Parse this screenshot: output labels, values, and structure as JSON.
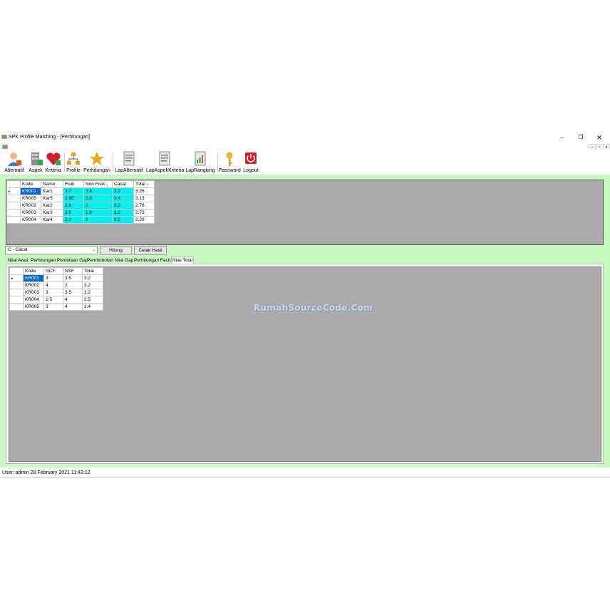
{
  "window": {
    "title": "SPK Profile Matching - [Perhitungan]",
    "minimize": "–",
    "maximize": "❐",
    "close": "✕",
    "mdi_minimize": "–",
    "mdi_restore": "▫",
    "mdi_close": "x"
  },
  "toolbar": {
    "items": [
      {
        "label": "Alternatif",
        "icon": "user-icon"
      },
      {
        "label": "Aspek",
        "icon": "server-icon"
      },
      {
        "label": "Kriteria",
        "icon": "heart-icon"
      },
      {
        "label": "Profile",
        "icon": "org-chart-icon"
      },
      {
        "label": "Perhitungan",
        "icon": "star-icon"
      },
      {
        "label": "LapAlternatif",
        "icon": "report-icon"
      },
      {
        "label": "LapAspekKriteria",
        "icon": "report-icon"
      },
      {
        "label": "LapRangking",
        "icon": "report-chart-icon"
      },
      {
        "label": "Password",
        "icon": "key-icon"
      },
      {
        "label": "Logout",
        "icon": "power-icon"
      }
    ]
  },
  "result_grid": {
    "columns": [
      "Kode",
      "Name",
      "Fisik",
      "Non Fisik",
      "Cacat",
      "Total"
    ],
    "sort_glyph": "▼",
    "rows": [
      [
        "KR001",
        "Kar1",
        "3.2",
        "3.4",
        "3.2",
        "3.26"
      ],
      [
        "KR005",
        "Kar5",
        "2.95",
        "2.8",
        "3.4",
        "3.13"
      ],
      [
        "KR002",
        "Kar2",
        "2.9",
        "2",
        "3.2",
        "2.78"
      ],
      [
        "KR003",
        "Kar3",
        "2.9",
        "1.8",
        "3.2",
        "2.72"
      ],
      [
        "KR004",
        "Kar4",
        "2.2",
        "2",
        "2.5",
        "2.29"
      ]
    ]
  },
  "controls": {
    "combo_value": "C - Cacat",
    "combo_arrow": "⌄",
    "hitung_label": "Hitung",
    "cetak_label": "Cetak Hasil"
  },
  "tabs": [
    "Nilai Awal",
    "Perhitungan Pemetaan Gap",
    "Pembobotan Nilai Gap",
    "Perhitungan Factor",
    "Nilai Total"
  ],
  "active_tab": "Nilai Total",
  "total_grid": {
    "columns": [
      "Kode",
      "NCF",
      "NSF",
      "Total"
    ],
    "rows": [
      [
        "KR001",
        "3",
        "3.5",
        "3.2"
      ],
      [
        "KR002",
        "4",
        "2",
        "3.2"
      ],
      [
        "KR003",
        "3",
        "3.5",
        "3.2"
      ],
      [
        "KR004",
        "1.5",
        "4",
        "2.5"
      ],
      [
        "KR005",
        "3",
        "4",
        "3.4"
      ]
    ]
  },
  "row_indicator": "▸",
  "watermark": "RumahSourceCode.Com",
  "status_bar": "User: admin  28 February 2021 11:43:12"
}
